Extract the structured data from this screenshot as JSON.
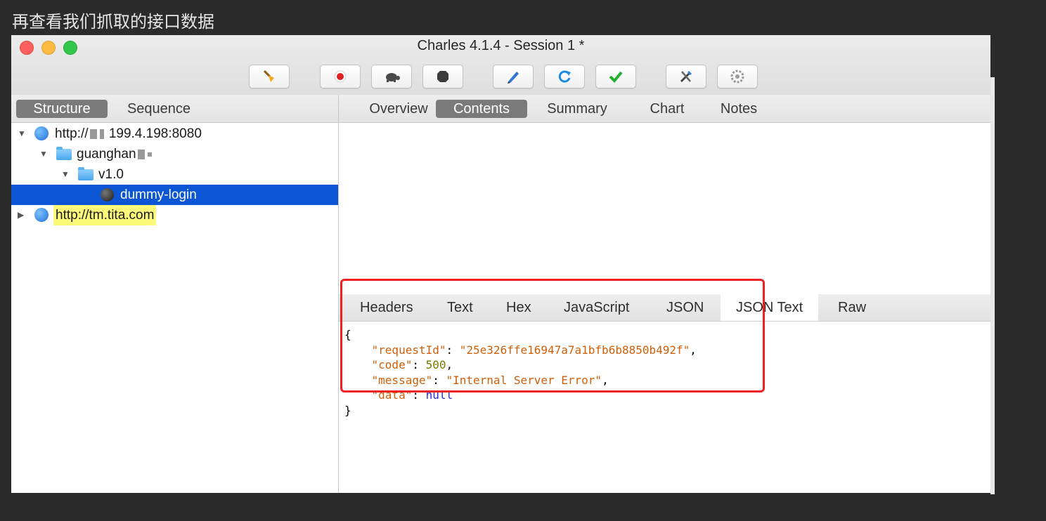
{
  "caption": "再查看我们抓取的接口数据",
  "window": {
    "title": "Charles 4.1.4 - Session 1 *"
  },
  "toolbar": {
    "buttons": [
      {
        "icon": "broom-icon"
      },
      {
        "icon": "record-icon"
      },
      {
        "icon": "turtle-icon"
      },
      {
        "icon": "stop-icon"
      },
      {
        "icon": "pen-icon"
      },
      {
        "icon": "refresh-icon"
      },
      {
        "icon": "check-icon"
      },
      {
        "icon": "tools-icon"
      },
      {
        "icon": "settings-icon"
      }
    ]
  },
  "left": {
    "tabs": [
      {
        "label": "Structure",
        "active": true
      },
      {
        "label": "Sequence",
        "active": false
      }
    ],
    "tree": [
      {
        "label": "http://",
        "suffix": "199.4.198:8080"
      },
      {
        "label": "guanghan"
      },
      {
        "label": "v1.0"
      },
      {
        "label": "dummy-login",
        "selected": true
      },
      {
        "label": "http://tm.tita.com",
        "highlight": true
      }
    ]
  },
  "right": {
    "tabs": [
      {
        "label": "Overview"
      },
      {
        "label": "Contents",
        "active": true
      },
      {
        "label": "Summary"
      },
      {
        "label": "Chart"
      },
      {
        "label": "Notes"
      }
    ],
    "subtabs": [
      {
        "label": "Headers"
      },
      {
        "label": "Text"
      },
      {
        "label": "Hex"
      },
      {
        "label": "JavaScript"
      },
      {
        "label": "JSON"
      },
      {
        "label": "JSON Text",
        "active": true
      },
      {
        "label": "Raw"
      }
    ],
    "json": {
      "open": "{",
      "close": "}",
      "fields": [
        {
          "key": "\"requestId\"",
          "value": "\"25e326ffe16947a7a1bfb6b8850b492f\"",
          "type": "string",
          "trail": ","
        },
        {
          "key": "\"code\"",
          "value": "500",
          "type": "number",
          "trail": ","
        },
        {
          "key": "\"message\"",
          "value": "\"Internal Server Error\"",
          "type": "string",
          "trail": ","
        },
        {
          "key": "\"data\"",
          "value": "null",
          "type": "null",
          "trail": ""
        }
      ]
    }
  },
  "colors": {
    "selection": "#0c56d6",
    "highlight": "#fff97a",
    "annotation_box": "#ee2222",
    "json_key": "#d05f08",
    "json_number": "#7a7a00",
    "json_null": "#2a2ad6"
  }
}
